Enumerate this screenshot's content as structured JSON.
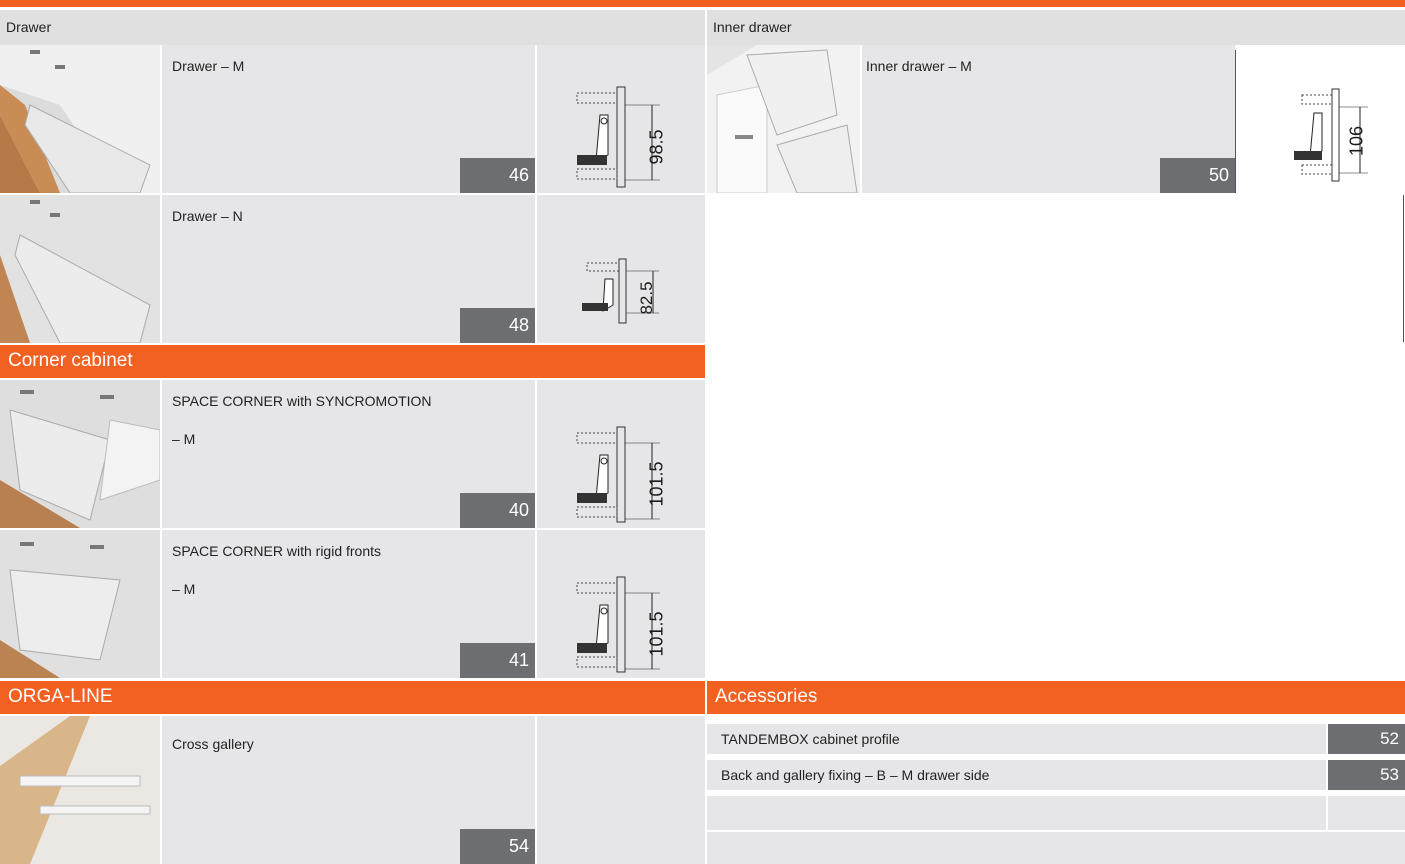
{
  "sections": {
    "drawer": "Drawer",
    "inner_drawer": "Inner drawer",
    "corner_cabinet": "Corner cabinet",
    "orga_line": "ORGA-LINE",
    "accessories": "Accessories"
  },
  "products": {
    "drawer_m": {
      "title": "Drawer – M",
      "page": "46",
      "dimension": "98.5"
    },
    "drawer_n": {
      "title": "Drawer – N",
      "page": "48",
      "dimension": "82.5"
    },
    "inner_drawer_m": {
      "title": "Inner drawer – M",
      "page": "50",
      "dimension": "106"
    },
    "space_corner_sync": {
      "title_line1": "SPACE CORNER with SYNCROMOTION",
      "title_line2": "– M",
      "page": "40",
      "dimension": "101.5"
    },
    "space_corner_rigid": {
      "title_line1": "SPACE CORNER with rigid fronts",
      "title_line2": "– M",
      "page": "41",
      "dimension": "101.5"
    },
    "cross_gallery": {
      "title": "Cross gallery",
      "page": "54"
    }
  },
  "accessories": [
    {
      "label": "TANDEMBOX cabinet profile",
      "page": "52"
    },
    {
      "label": "Back and gallery fixing – B – M drawer side",
      "page": "53"
    }
  ],
  "colors": {
    "accent": "#f26122",
    "panel": "#e6e6e8",
    "page_box": "#6d6e71"
  }
}
